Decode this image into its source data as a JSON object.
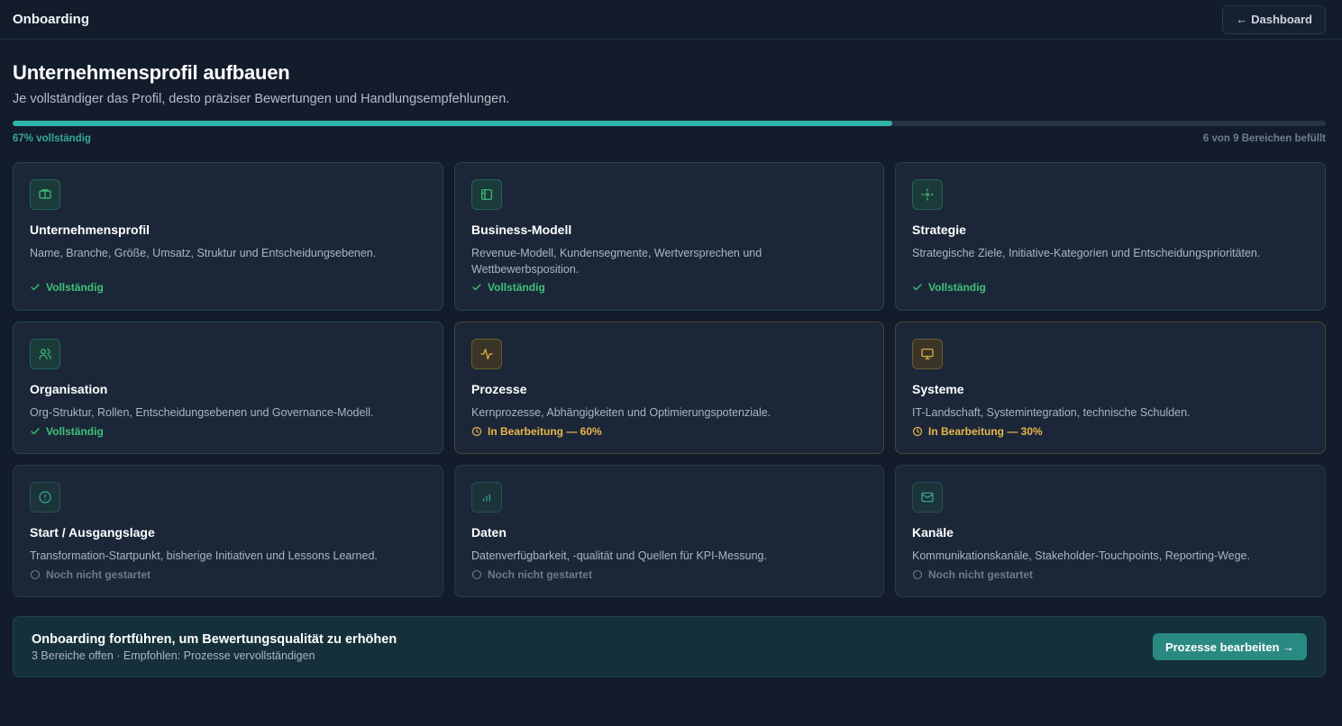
{
  "header": {
    "title": "Onboarding",
    "dashboard_button": "← Dashboard"
  },
  "page": {
    "title": "Unternehmensprofil aufbauen",
    "subtitle": "Je vollständiger das Profil, desto präziser Bewertungen und Handlungsempfehlungen."
  },
  "progress": {
    "value": 0.67,
    "percent_label": "67% vollständig",
    "count_label": "6 von 9 Bereichen befüllt"
  },
  "colors": {
    "accent": "#2fb5a8",
    "done": "#3fc179",
    "in_progress": "#e8b54a",
    "todo": "#6d7a8c",
    "background": "#121c2b"
  },
  "cards": [
    {
      "icon": "building-icon",
      "title": "Unternehmensprofil",
      "description": "Name, Branche, Größe, Umsatz, Struktur und Entscheidungsebenen.",
      "state": "done",
      "status": "Vollständig"
    },
    {
      "icon": "layout-icon",
      "title": "Business-Modell",
      "description": "Revenue-Modell, Kundensegmente, Wertversprechen und Wettbewerbsposition.",
      "state": "done",
      "status": "Vollständig"
    },
    {
      "icon": "crosshair-icon",
      "title": "Strategie",
      "description": "Strategische Ziele, Initiative-Kategorien und Entscheidungsprioritäten.",
      "state": "done",
      "status": "Vollständig"
    },
    {
      "icon": "users-icon",
      "title": "Organisation",
      "description": "Org-Struktur, Rollen, Entscheidungsebenen und Governance-Modell.",
      "state": "done",
      "status": "Vollständig"
    },
    {
      "icon": "activity-icon",
      "title": "Prozesse",
      "description": "Kernprozesse, Abhängigkeiten und Optimierungspotenziale.",
      "state": "progress",
      "status": "In Bearbeitung — 60%"
    },
    {
      "icon": "monitor-icon",
      "title": "Systeme",
      "description": "IT-Landschaft, Systemintegration, technische Schulden.",
      "state": "progress",
      "status": "In Bearbeitung — 30%"
    },
    {
      "icon": "alert-circle-icon",
      "title": "Start / Ausgangslage",
      "description": "Transformation-Startpunkt, bisherige Initiativen und Lessons Learned.",
      "state": "todo",
      "status": "Noch nicht gestartet"
    },
    {
      "icon": "bar-chart-icon",
      "title": "Daten",
      "description": "Datenverfügbarkeit, -qualität und Quellen für KPI-Messung.",
      "state": "todo",
      "status": "Noch nicht gestartet"
    },
    {
      "icon": "mail-icon",
      "title": "Kanäle",
      "description": "Kommunikationskanäle, Stakeholder-Touchpoints, Reporting-Wege.",
      "state": "todo",
      "status": "Noch nicht gestartet"
    }
  ],
  "cta": {
    "title": "Onboarding fortführen, um Bewertungsqualität zu erhöhen",
    "subtitle": "3 Bereiche offen · Empfohlen: Prozesse vervollständigen",
    "button": "Prozesse bearbeiten →"
  }
}
